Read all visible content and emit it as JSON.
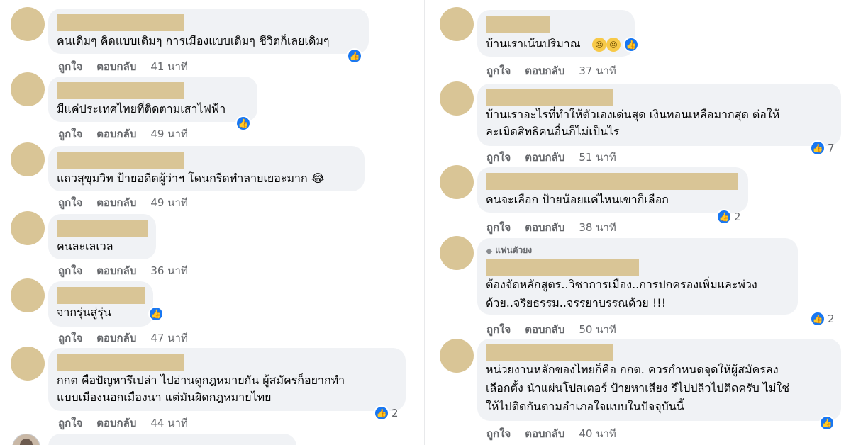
{
  "labels": {
    "like": "ถูกใจ",
    "reply": "ตอบกลับ"
  },
  "icons": {
    "like": "thumbs-up-icon",
    "emoji": "face-emoji-icon",
    "fan": "diamond-icon"
  },
  "colors": {
    "bubble": "#f0f2f5",
    "like": "#1877f2",
    "redaction": "#d9c596",
    "meta": "#65676b"
  },
  "left_column": [
    {
      "text_lines": [
        "คนเดิมๆ คิดแบบเดิมๆ การเมืองแบบเดิมๆ ชีวิตก็เลยเดิมๆ"
      ],
      "time": "41 นาที",
      "like_count": ""
    },
    {
      "text_lines": [
        "มีแค่ประเทศไทยที่ติดตามเสาไฟฟ้า"
      ],
      "time": "49 นาที",
      "like_count": ""
    },
    {
      "text_lines": [
        "แถวสุขุมวิท ป้ายอดีตผู้ว่าฯ โดนกรีดทำลายเยอะมาก 😂"
      ],
      "time": "49 นาที",
      "like_count": ""
    },
    {
      "text_lines": [
        "คนละเลเวล"
      ],
      "time": "36 นาที",
      "like_count": ""
    },
    {
      "text_lines": [
        "จากรุ่นสู่รุ่น"
      ],
      "time": "47 นาที",
      "like_count": ""
    },
    {
      "text_lines": [
        "กกต คือปัญหารึเปล่า ไปอ่านดูกฎหมายกัน ผู้สมัครก็อยากทำ",
        "แบบเมืองนอกเมืองนา แต่มันผิดกฎหมายไทย"
      ],
      "time": "44 นาที",
      "like_count": "2"
    }
  ],
  "right_column": [
    {
      "text_lines": [
        "บ้านเราเน้นปริมาณ"
      ],
      "time": "37 นาที",
      "like_count": ""
    },
    {
      "text_lines": [
        "บ้านเราอะไรที่ทำให้ตัวเองเด่นสุด เงินทอนเหลือมากสุด ต่อให้",
        "ละเมิดสิทธิคนอื่นก็ไม่เป็นไร"
      ],
      "time": "51 นาที",
      "like_count": "7"
    },
    {
      "text_lines": [
        "คนจะเลือก ป้ายน้อยแค่ไหนเขาก็เลือก"
      ],
      "time": "38 นาที",
      "like_count": "2"
    },
    {
      "badge": "แฟนตัวยง",
      "text_lines": [
        "ต้องจัดหลักสูตร..วิชาการเมือง..การปกครองเพิ่มและพ่วง",
        "ด้วย..จริยธรรม..จรรยาบรรณด้วย !!!"
      ],
      "time": "50 นาที",
      "like_count": "2"
    },
    {
      "text_lines": [
        "หน่วยงานหลักของไทยก็คือ กกต. ควรกำหนดจุดให้ผู้สมัครลง",
        "เลือกตั้ง นำแผ่นโปสเตอร์ ป้ายหาเสียง รีไปปลิวไปติดครับ ไม่ใช่",
        "ให้ไปติดกันตามอำเภอใจแบบในปัจจุบันนี้"
      ],
      "time": "40 นาที",
      "like_count": ""
    }
  ]
}
